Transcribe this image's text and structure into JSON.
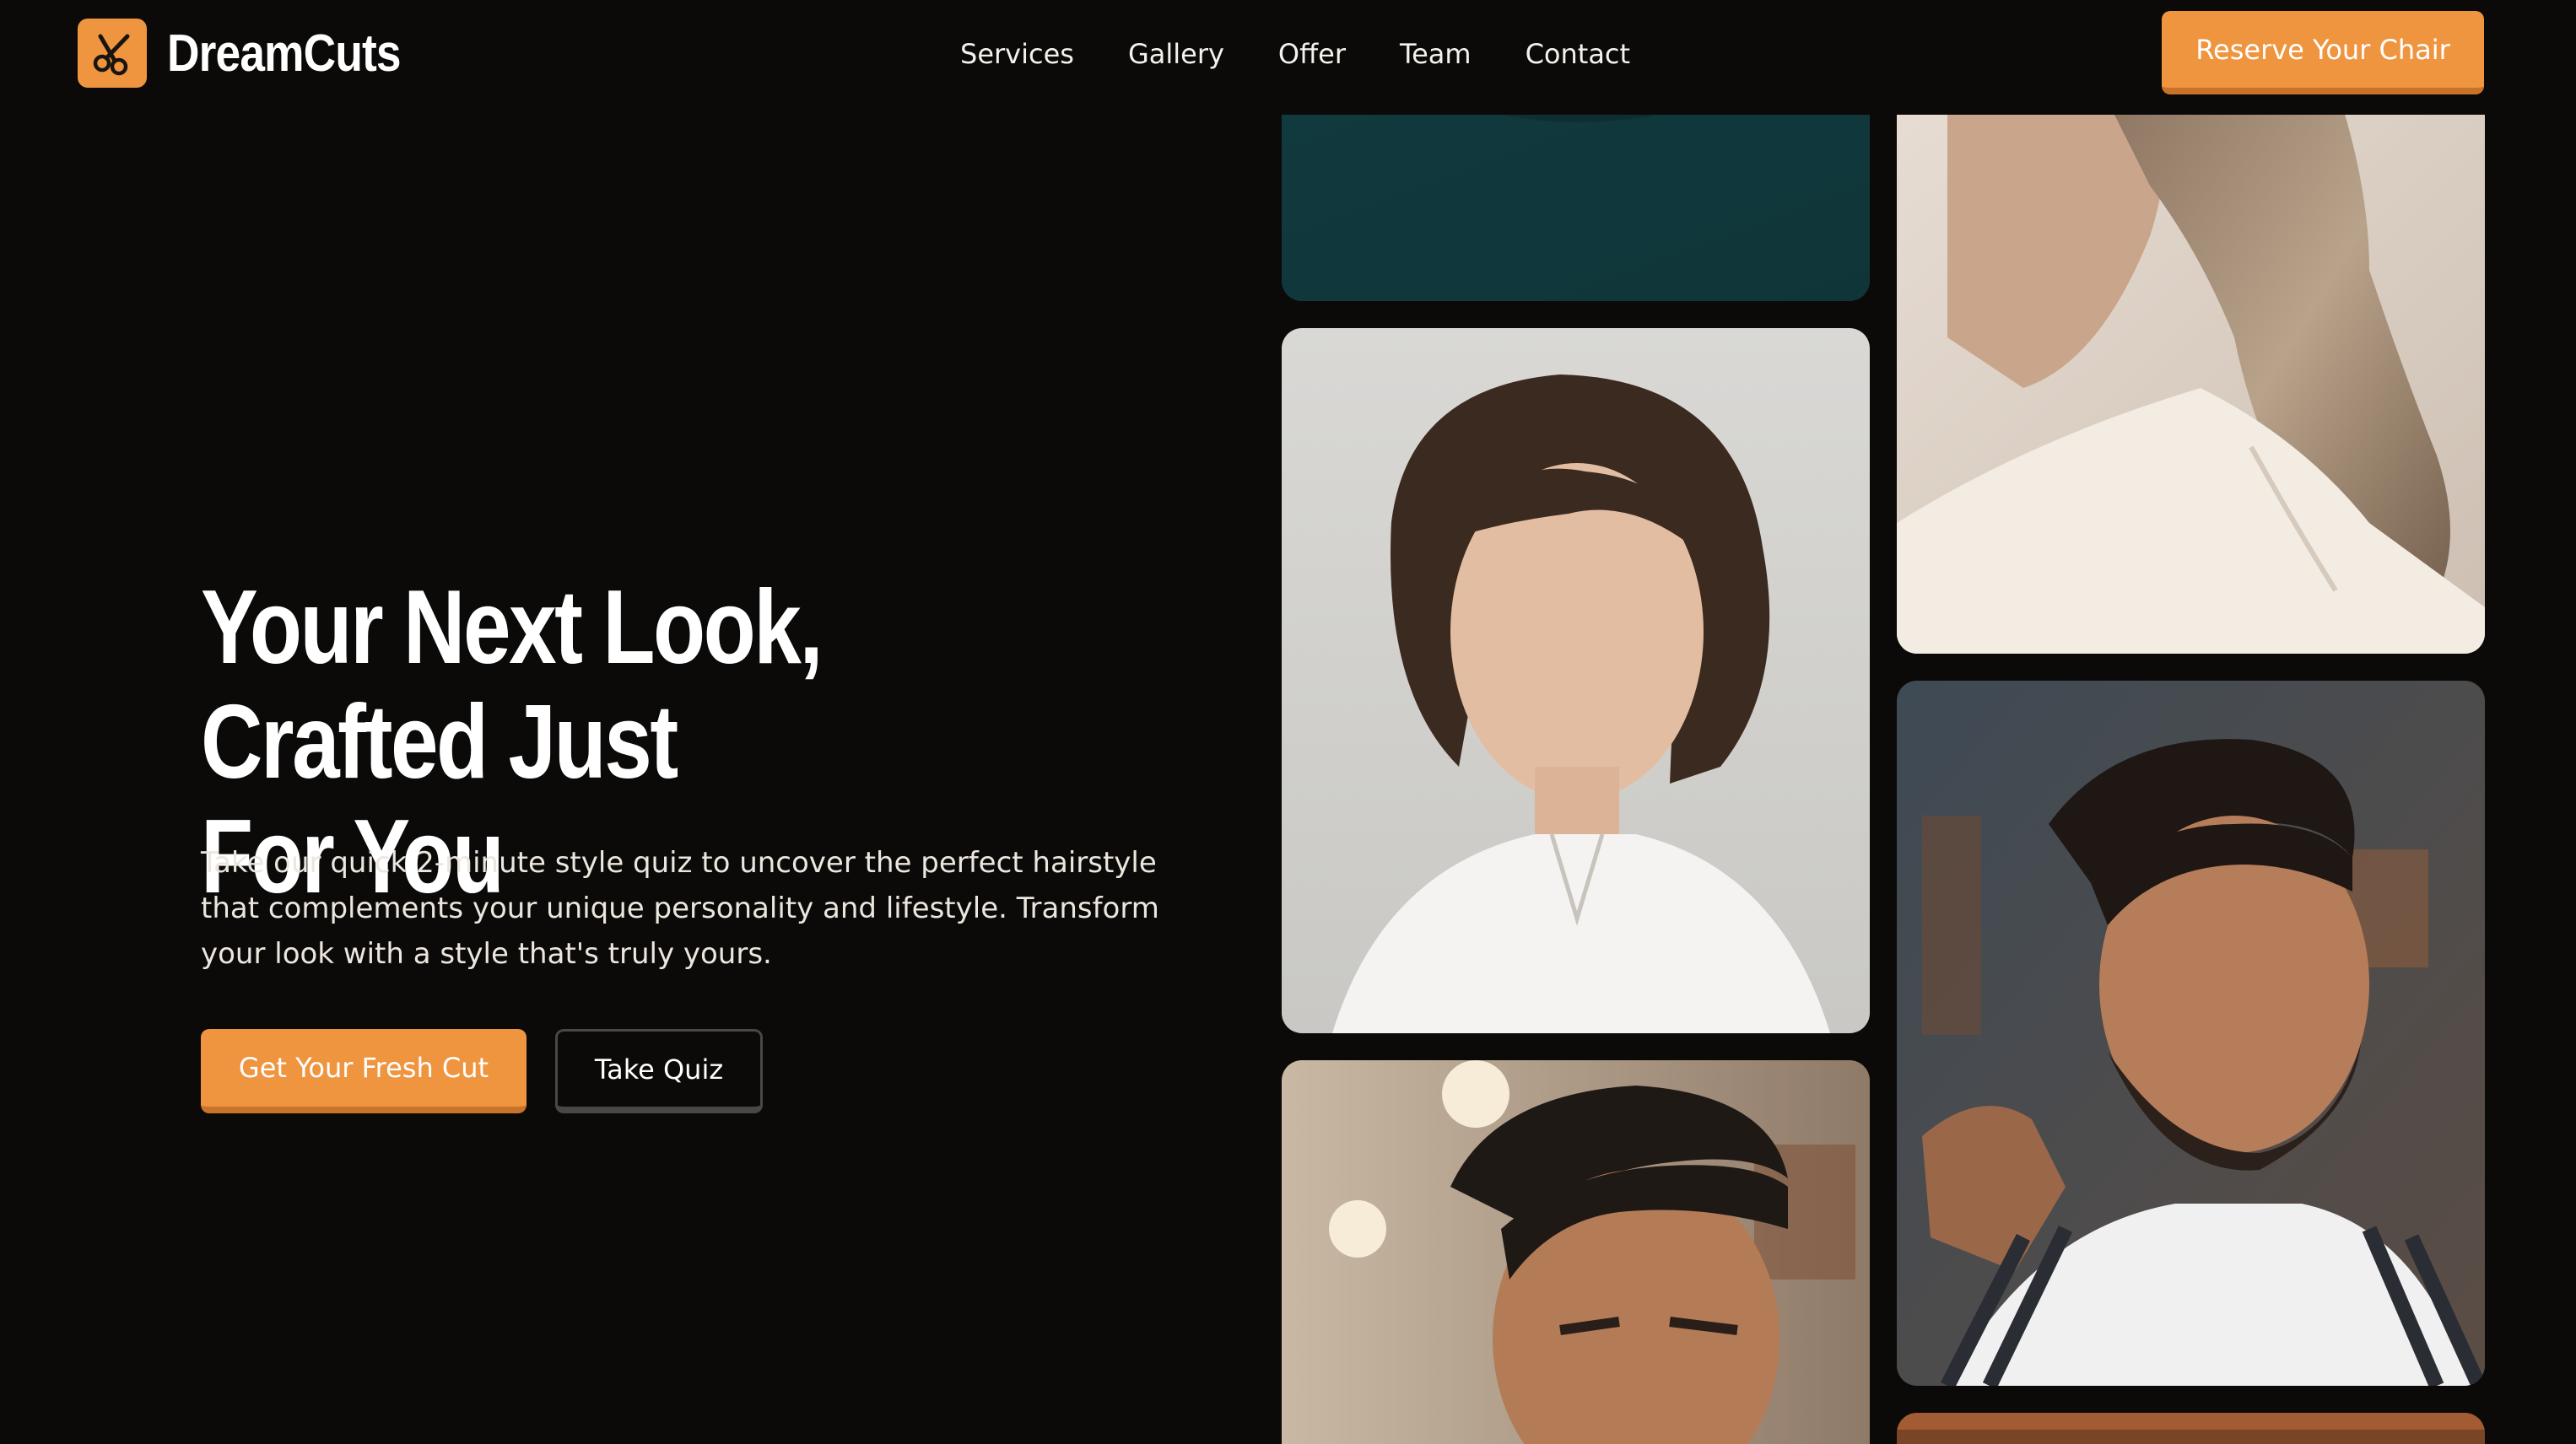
{
  "brand": {
    "name": "DreamCuts",
    "logo_icon": "scissors-icon",
    "accent": "#ef9540"
  },
  "nav": {
    "links": [
      "Services",
      "Gallery",
      "Offer",
      "Team",
      "Contact"
    ],
    "reserve_label": "Reserve Your Chair"
  },
  "hero": {
    "title_line1": "Your Next Look, Crafted Just",
    "title_line2": "For You",
    "description": "Take our quick 2-minute style quiz to uncover the perfect hairstyle that complements your unique personality and lifestyle. Transform your look with a style that's truly yours.",
    "primary_cta": "Get Your Fresh Cut",
    "secondary_cta": "Take Quiz"
  },
  "gallery": {
    "images": [
      "teal-cape-portrait",
      "long-wavy-hair-portrait",
      "side-profile-wavy-ponytail",
      "barber-fade-cut-portrait",
      "pompadour-fade-portrait",
      "partial-barbershop-image"
    ]
  },
  "colors": {
    "background": "#0b0a09",
    "accent": "#ef9540",
    "text": "#ffffff"
  }
}
